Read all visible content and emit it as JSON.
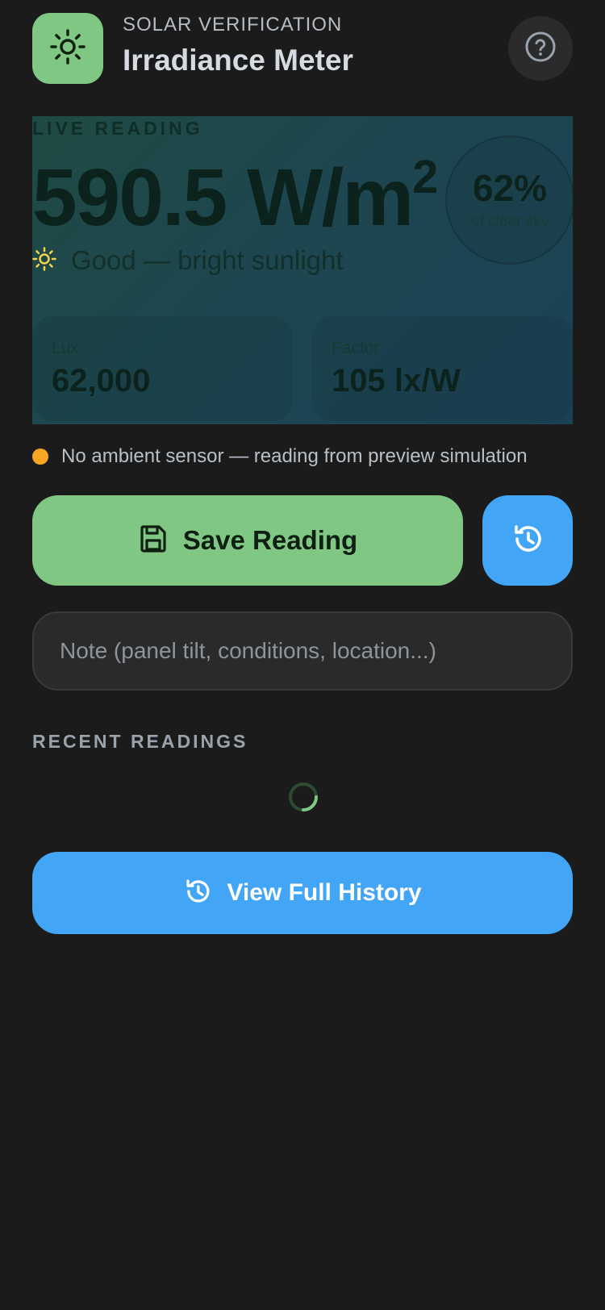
{
  "header": {
    "kicker": "SOLAR VERIFICATION",
    "title": "Irradiance Meter",
    "app_icon": "sun-icon",
    "help_icon": "help-circle-icon"
  },
  "live": {
    "label": "LIVE READING",
    "value": "590.5 W/m",
    "unit_superscript": "2",
    "percent": "62%",
    "percent_caption": "of clear sky",
    "condition_icon": "sun-icon",
    "condition": "Good — bright sunlight",
    "stats": [
      {
        "label": "Lux",
        "value": "62,000"
      },
      {
        "label": "Factor",
        "value": "105 lx/W"
      }
    ]
  },
  "notice": {
    "text": "No ambient sensor — reading from preview simulation",
    "dot_color": "#f5a623"
  },
  "actions": {
    "save_label": "Save Reading",
    "save_icon": "floppy-disk-icon",
    "history_icon": "history-icon"
  },
  "note": {
    "placeholder": "Note (panel tilt, conditions, location...)",
    "value": ""
  },
  "recent": {
    "title": "RECENT READINGS",
    "loading": true
  },
  "full_history": {
    "label": "View Full History",
    "icon": "history-icon"
  },
  "colors": {
    "background": "#1b1b1b",
    "accent_green": "#81c784",
    "accent_blue": "#42a5f5",
    "warning": "#f5a623"
  }
}
